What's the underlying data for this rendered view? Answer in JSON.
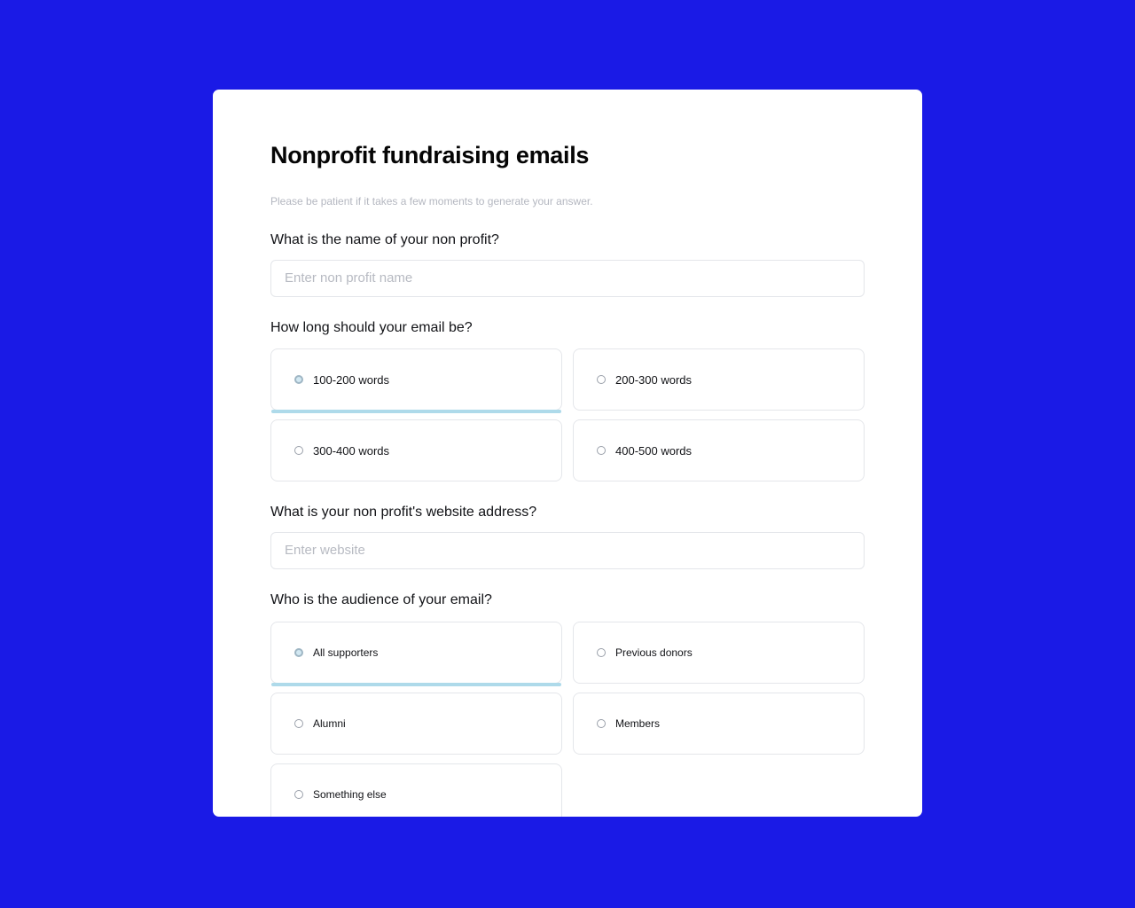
{
  "theme": {
    "background_color": "#1a1ae6",
    "panel_color": "#ffffff",
    "accent_color": "#aedaea",
    "border_color": "#e4e6ea",
    "text_color": "#111216",
    "muted_text_color": "#b4b7c0"
  },
  "form": {
    "title": "Nonprofit fundraising emails",
    "subtitle": "Please be patient if it takes a few moments to generate your answer.",
    "questions": [
      {
        "id": "nonprofit-name",
        "label": "What is the name of your non profit?",
        "type": "text",
        "value": "",
        "placeholder": "Enter non profit name"
      },
      {
        "id": "email-length",
        "label": "How long should your email be?",
        "type": "radio-cards",
        "selected_index": 0,
        "options": [
          {
            "label": "100-200 words",
            "selected": true
          },
          {
            "label": "200-300 words",
            "selected": false
          },
          {
            "label": "300-400 words",
            "selected": false
          },
          {
            "label": "400-500 words",
            "selected": false
          }
        ]
      },
      {
        "id": "website-address",
        "label": "What is your non profit's website address?",
        "type": "text",
        "value": "",
        "placeholder": "Enter website"
      },
      {
        "id": "audience",
        "label": "Who is the audience of your email?",
        "type": "radio-cards",
        "selected_index": 0,
        "options": [
          {
            "label": "All supporters",
            "selected": true
          },
          {
            "label": "Previous donors",
            "selected": false
          },
          {
            "label": "Alumni",
            "selected": false
          },
          {
            "label": "Members",
            "selected": false
          },
          {
            "label": "Something else",
            "selected": false
          }
        ]
      }
    ]
  }
}
